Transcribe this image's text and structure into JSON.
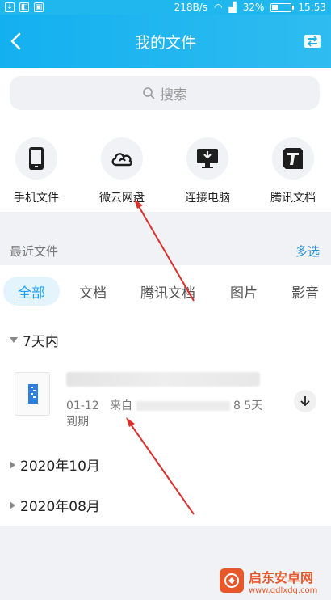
{
  "status_bar": {
    "speed": "218B/s",
    "battery": "32%",
    "time": "15:53"
  },
  "header": {
    "title": "我的文件"
  },
  "search": {
    "placeholder": "搜索"
  },
  "quick_access": [
    {
      "label": "手机文件",
      "icon": "phone-icon"
    },
    {
      "label": "微云网盘",
      "icon": "cloud-icon"
    },
    {
      "label": "连接电脑",
      "icon": "monitor-icon"
    },
    {
      "label": "腾讯文档",
      "icon": "tencent-docs-icon"
    }
  ],
  "recent": {
    "title": "最近文件",
    "multi_select": "多选"
  },
  "tabs": [
    "全部",
    "文档",
    "腾讯文档",
    "图片",
    "影音"
  ],
  "groups": {
    "within_7_days": "7天内",
    "oct_2020": "2020年10月",
    "aug_2020": "2020年08月"
  },
  "file": {
    "date": "01-12",
    "from_label": "来自",
    "expiry_days": "8 5天",
    "expiry_suffix": "到期"
  },
  "watermark": {
    "title": "启东安卓网",
    "url": "www.qdlxdq.com"
  },
  "colors": {
    "accent": "#20b6ee",
    "tab_active": "#1da1f2",
    "link": "#2a93d5",
    "annotation_arrow": "#d9302c"
  }
}
